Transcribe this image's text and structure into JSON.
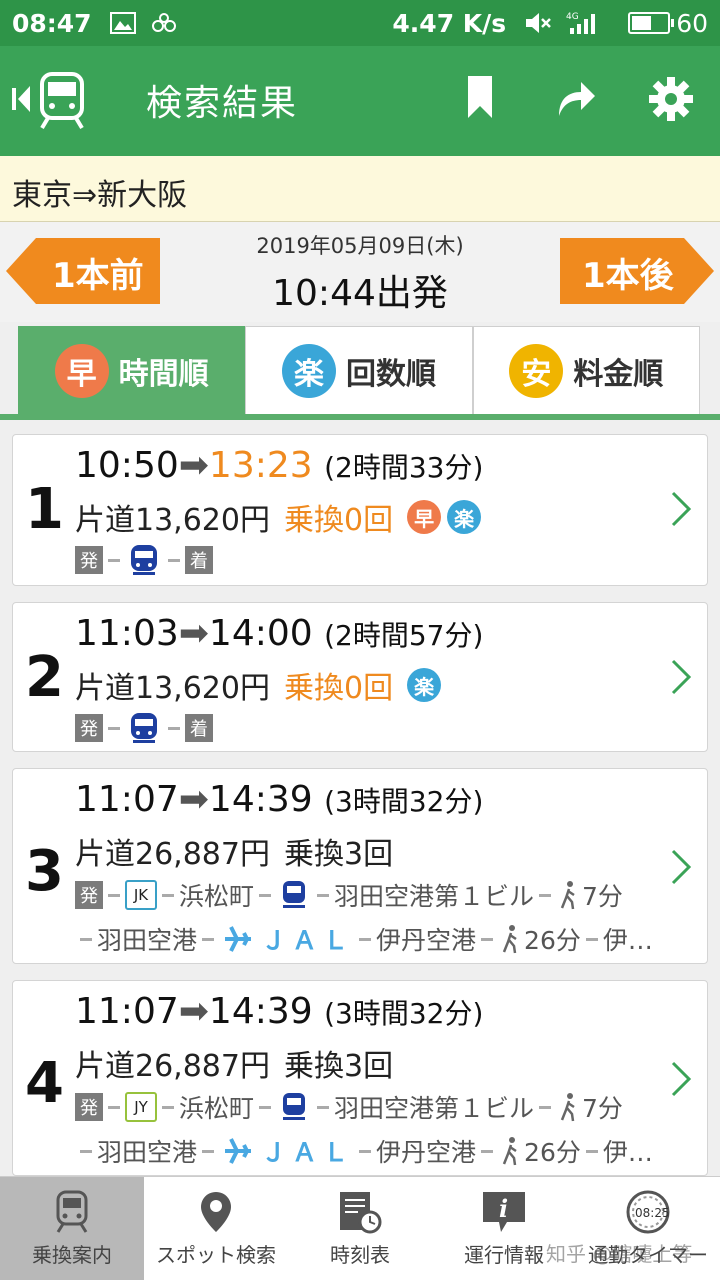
{
  "status_bar": {
    "time": "08:47",
    "speed": "4.47 K/s",
    "network": "4G",
    "battery": "60",
    "battery_level": 0.6
  },
  "header": {
    "title": "検索結果"
  },
  "route": {
    "text": "東京⇒新大阪"
  },
  "date_row": {
    "prev_label": "1本前",
    "next_label": "1本後",
    "date": "2019年05月09日(木)",
    "departure": "10:44出発"
  },
  "tabs": [
    {
      "icon_char": "早",
      "label": "時間順",
      "color": "#ef7a4a"
    },
    {
      "icon_char": "楽",
      "label": "回数順",
      "color": "#3aa6d8"
    },
    {
      "icon_char": "安",
      "label": "料金順",
      "color": "#f0b400"
    }
  ],
  "common": {
    "depart_char": "発",
    "arrive_char": "着"
  },
  "results": [
    {
      "num": "1",
      "dep": "10:50",
      "arr": "13:23",
      "duration": "(2時間33分)",
      "fare": "片道13,620円",
      "transfers": "乗換0回",
      "badge1": "早",
      "badge2": "楽"
    },
    {
      "num": "2",
      "dep": "11:03",
      "arr": "14:00",
      "duration": "(2時間57分)",
      "fare": "片道13,620円",
      "transfers": "乗換0回",
      "badge2": "楽"
    },
    {
      "num": "3",
      "dep": "11:07",
      "arr": "14:39",
      "duration": "(3時間32分)",
      "fare": "片道26,887円",
      "transfers": "乗換3回",
      "line_code": "JK",
      "station1": "浜松町",
      "station2": "羽田空港第１ビル",
      "walk1": "7分",
      "station3": "羽田空港",
      "airline": "ＪＡＬ",
      "station4": "伊丹空港",
      "walk2": "26分",
      "station5": "伊…"
    },
    {
      "num": "4",
      "dep": "11:07",
      "arr": "14:39",
      "duration": "(3時間32分)",
      "fare": "片道26,887円",
      "transfers": "乗換3回",
      "line_code": "JY",
      "station1": "浜松町",
      "station2": "羽田空港第１ビル",
      "walk1": "7分",
      "station3": "羽田空港",
      "airline": "ＪＡＬ",
      "station4": "伊丹空港",
      "walk2": "26分",
      "station5": "伊…"
    }
  ],
  "bottom_nav": [
    {
      "label": "乗換案内"
    },
    {
      "label": "スポット検索"
    },
    {
      "label": "時刻表"
    },
    {
      "label": "運行情報"
    },
    {
      "label": "通勤タイマー",
      "clock_text": "08:25"
    }
  ],
  "watermark": "知乎 @瞎嚏上等"
}
